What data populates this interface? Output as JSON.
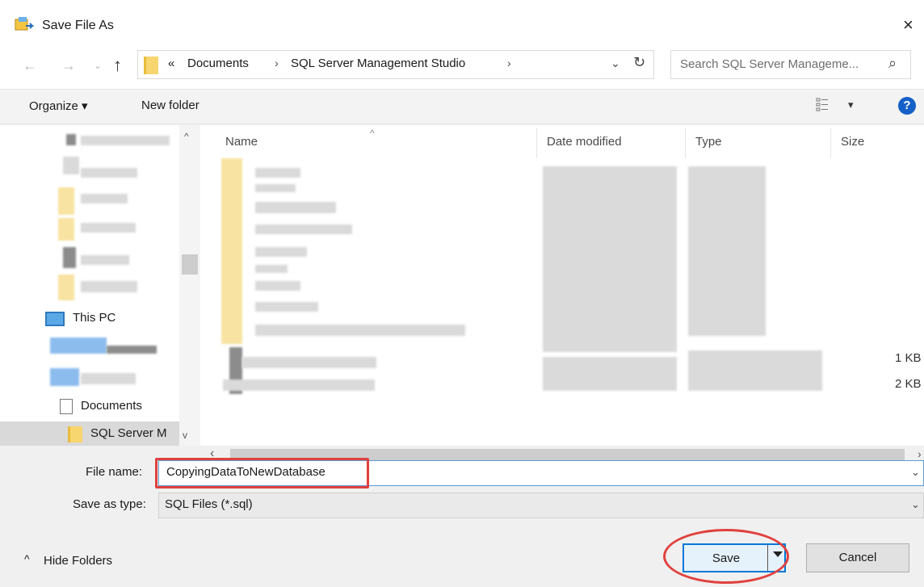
{
  "window": {
    "title": "Save File As",
    "close_glyph": "×",
    "app_icon": "save-as-icon"
  },
  "navigation": {
    "back_glyph": "←",
    "forward_glyph": "→",
    "history_glyph": "⌄",
    "up_glyph": "↑",
    "breadcrumb_prefix": "«",
    "breadcrumb": [
      "Documents",
      "SQL Server Management Studio"
    ],
    "separator": "›",
    "dropdown_glyph": "⌄",
    "refresh_glyph": "↻",
    "search_placeholder": "Search SQL Server Manageme...",
    "search_glyph": "⌕"
  },
  "toolbar": {
    "organize_label": "Organize ▾",
    "new_folder_label": "New folder",
    "view_caret": "▾",
    "help_label": "?"
  },
  "nav_pane": {
    "this_pc_label": "This PC",
    "documents_label": "Documents",
    "selected_folder_label": "SQL Server M"
  },
  "columns": {
    "name": "Name",
    "date_modified": "Date modified",
    "type": "Type",
    "size": "Size"
  },
  "files": {
    "size_1": "1 KB",
    "size_2": "2 KB"
  },
  "form": {
    "filename_label": "File name:",
    "filename_value": "CopyingDataToNewDatabase",
    "savetype_label": "Save as type:",
    "savetype_value": "SQL Files (*.sql)",
    "caret": "⌄"
  },
  "footer": {
    "hide_folders_caret": "^",
    "hide_folders_label": "Hide Folders",
    "save_label": "Save",
    "cancel_label": "Cancel"
  },
  "colors": {
    "highlight_annotation": "#e0413e",
    "primary_border": "#0078d7"
  }
}
